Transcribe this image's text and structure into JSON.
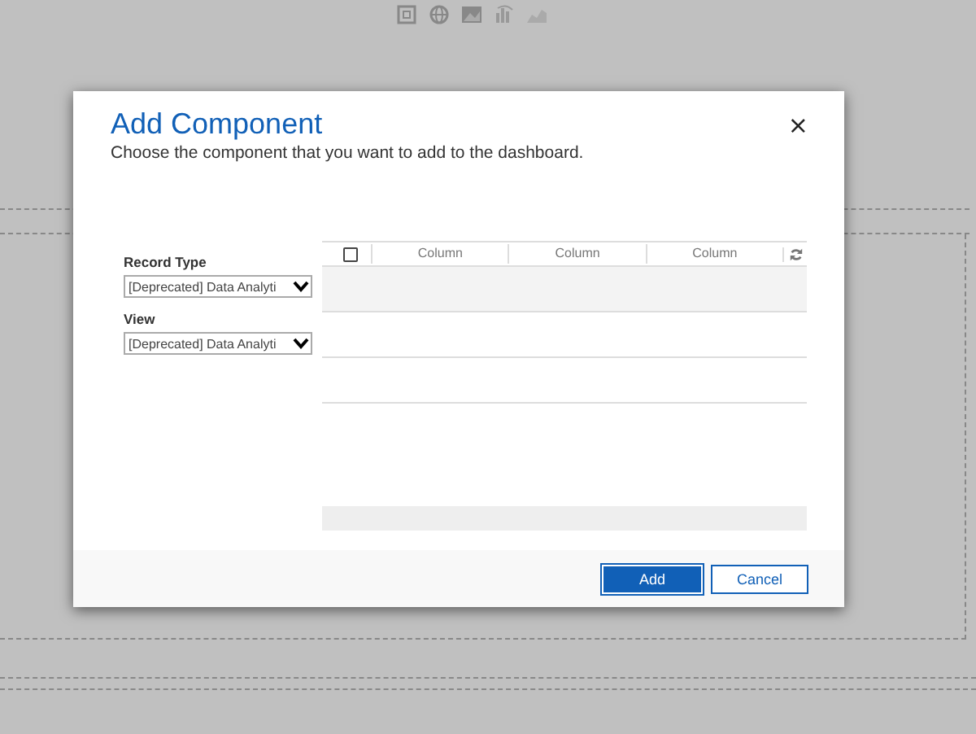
{
  "dialog": {
    "title": "Add Component",
    "close": "×",
    "subtitle": "Choose the component that you want to add to the dashboard.",
    "fields": [
      {
        "label": "Record Type",
        "value": "[Deprecated] Data Analyti"
      },
      {
        "label": "View",
        "value": "[Deprecated] Data Analyti"
      }
    ],
    "grid": {
      "select_all": {
        "checked": false
      },
      "columns": [
        "Column",
        "Column",
        "Column"
      ]
    },
    "buttons": [
      {
        "label": "Add",
        "kind": "primary"
      },
      {
        "label": "Cancel",
        "kind": "secondary"
      }
    ]
  }
}
